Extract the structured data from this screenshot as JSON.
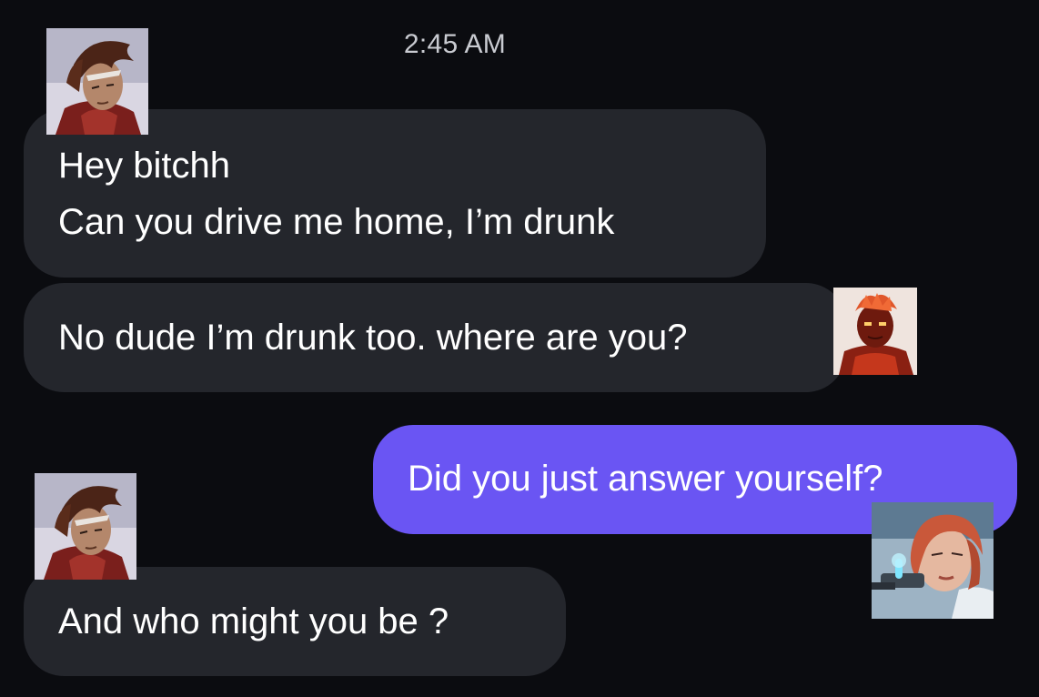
{
  "conversation": {
    "timestamp": "2:45 AM",
    "messages": [
      {
        "sender": "incoming",
        "lines": [
          "Hey bitchh",
          "Can you drive me home, I’m drunk"
        ],
        "avatar": "dark-haired-character-avatar"
      },
      {
        "sender": "incoming",
        "lines": [
          "No dude I’m drunk too. where are you?"
        ],
        "avatar": "fiery-character-avatar"
      },
      {
        "sender": "outgoing",
        "lines": [
          "Did you just answer yourself?"
        ],
        "avatar": "red-haired-character-avatar"
      },
      {
        "sender": "incoming",
        "lines": [
          "And who might you be ?"
        ],
        "avatar": "dark-haired-character-avatar"
      }
    ]
  },
  "colors": {
    "background": "#0b0c10",
    "incoming_bubble": "#24262c",
    "outgoing_bubble": "#6a55f3",
    "timestamp_text": "#c9cbd1"
  }
}
